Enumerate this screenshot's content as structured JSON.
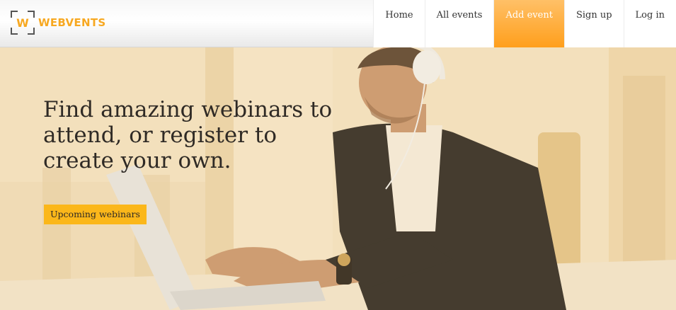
{
  "brand": {
    "mark_letter": "W",
    "name": "WEBVENTS"
  },
  "nav": [
    {
      "label": "Home",
      "active": false
    },
    {
      "label": "All events",
      "active": false
    },
    {
      "label": "Add event",
      "active": true
    },
    {
      "label": "Sign up",
      "active": false
    },
    {
      "label": "Log in",
      "active": false
    }
  ],
  "hero": {
    "headline": "Find amazing webinars to attend, or register to create your own.",
    "cta_label": "Upcoming webinars",
    "image_subject": "man-with-headphones-at-laptop-photo"
  },
  "colors": {
    "accent": "#fbb71a",
    "nav_active": "#ff9f1c",
    "text_dark": "#2f2a25"
  }
}
